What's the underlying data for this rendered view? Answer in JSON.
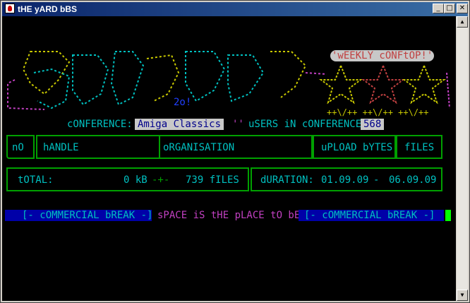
{
  "window": {
    "title": "tHE yARD bBS"
  },
  "banner": {
    "badge": "'wEEKLY cONFtOP!'",
    "tag": "2o!"
  },
  "conference": {
    "label": "cONFERENCE:",
    "name": "Amiga Classics",
    "quote": "''",
    "users_label": "uSERS iN cONFERENCE",
    "users_count": "568"
  },
  "table": {
    "headers": [
      "nO",
      "hANDLE",
      "oRGANISATION",
      "uPLOAD bYTES",
      "fILES"
    ]
  },
  "totals": {
    "label": "tOTAL:",
    "kb": "0 kB",
    "files": "739 fILES",
    "duration_label": "dURATION:",
    "from": "01.09.09",
    "to": "06.09.09"
  },
  "footer": {
    "break_left": "[- cOMMERCIAL bREAK -]",
    "slogan": "sPACE iS tHE pLACE tO bE",
    "break_right": "[- cOMMERCIAL bREAK -]"
  },
  "colors": {
    "cyan": "#00c0c0",
    "green": "#00a000",
    "magenta": "#c040c0",
    "blue": "#0000a8"
  }
}
